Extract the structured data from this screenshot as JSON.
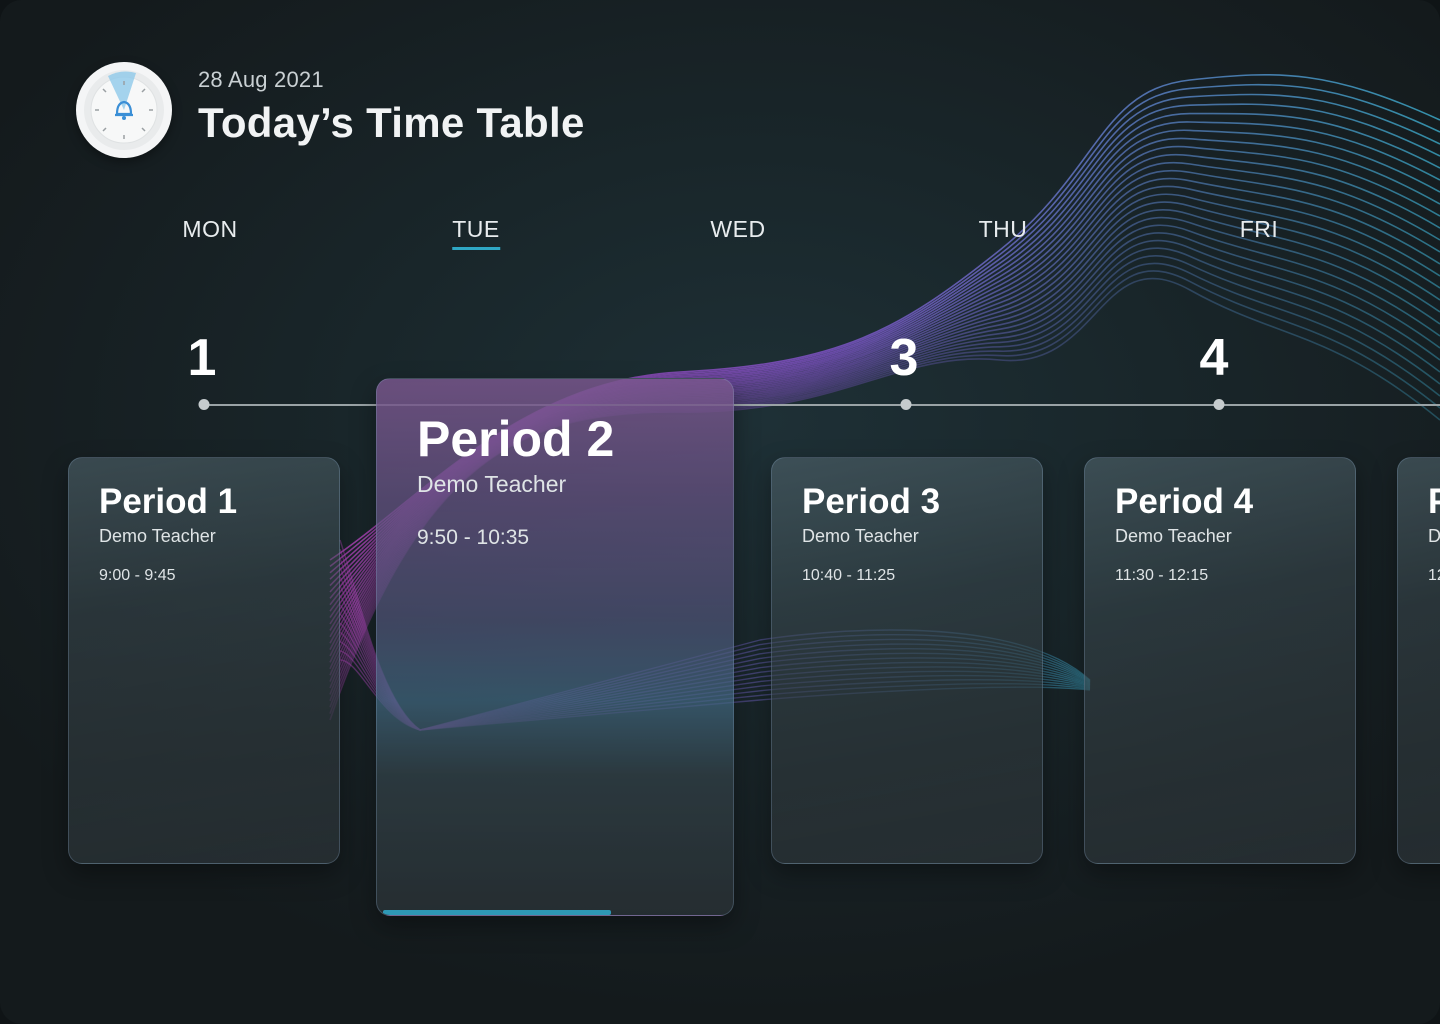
{
  "header": {
    "date": "28 Aug 2021",
    "title": "Today’s Time Table",
    "clock_icon": "bell-clock-icon"
  },
  "days": [
    {
      "label": "MON",
      "active": false
    },
    {
      "label": "TUE",
      "active": true
    },
    {
      "label": "WED",
      "active": false
    },
    {
      "label": "THU",
      "active": false
    },
    {
      "label": "FRI",
      "active": false
    }
  ],
  "timeline": {
    "numbers": [
      "1",
      "3",
      "4"
    ]
  },
  "periods": [
    {
      "title": "Period 1",
      "teacher": "Demo Teacher",
      "time": "9:00 - 9:45"
    },
    {
      "title": "Period 2",
      "teacher": "Demo Teacher",
      "time": "9:50 - 10:35",
      "active": true,
      "progress": 0.64
    },
    {
      "title": "Period 3",
      "teacher": "Demo Teacher",
      "time": "10:40 - 11:25"
    },
    {
      "title": "Period 4",
      "teacher": "Demo Teacher",
      "time": "11:30 - 12:15"
    },
    {
      "title": "P",
      "teacher": "D",
      "time": "12"
    }
  ],
  "colors": {
    "accent": "#2fa7c4",
    "wave_purple": "#b043b8",
    "wave_teal": "#3aa6c4"
  }
}
